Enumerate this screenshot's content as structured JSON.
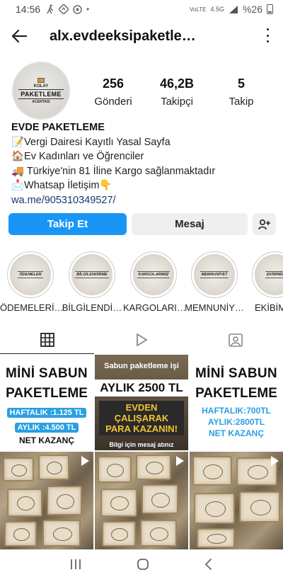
{
  "status_bar": {
    "time": "14:56",
    "network": "VoLTE",
    "signal": "4.5G",
    "battery": "%26"
  },
  "header": {
    "username": "alx.evdeeksipaketle…"
  },
  "profile": {
    "avatar": {
      "line1": "KOLAY",
      "line2": "PAKETLEME",
      "line3": "ACENTASI"
    },
    "stats": [
      {
        "value": "256",
        "label": "Gönderi"
      },
      {
        "value": "46,2B",
        "label": "Takipçi"
      },
      {
        "value": "5",
        "label": "Takip"
      }
    ],
    "name": "EVDE PAKETLEME",
    "bio": [
      "📝Vergi Dairesi Kayıtlı Yasal Sayfa",
      "🏠Ev Kadınları ve Öğrenciler",
      "🚚 Türkiye'nin 81 İline  Kargo sağlanmaktadır",
      "📩Whatsap İletişim👇"
    ],
    "link": "wa.me/905310349527/"
  },
  "actions": {
    "follow": "Takip Et",
    "message": "Mesaj"
  },
  "highlights": [
    {
      "badge": "ÖDEMELER",
      "caption": "ÖDEMELERİ…"
    },
    {
      "badge": "BİLGİLENDİRME",
      "caption": "BİLGİLENDİ…"
    },
    {
      "badge": "KARGOLARIMIZ",
      "caption": "KARGOLARI…"
    },
    {
      "badge": "MEMNUNİYET",
      "caption": "MEMNUNİY…"
    },
    {
      "badge": "EKİBİMİZ",
      "caption": "EKİBİM"
    }
  ],
  "posts": {
    "p1": {
      "l1": "MİNİ SABUN",
      "l2": "PAKETLEME",
      "l3": "HAFTALIK :1.125 TL",
      "l4": "AYLIK :4.500 TL",
      "l5": "NET KAZANÇ"
    },
    "p2": {
      "l1": "Sabun paketleme işi",
      "l2": "AYLIK 2500 TL",
      "l3": "EVDEN ÇALIŞARAK",
      "l4": "PARA KAZANIN!",
      "l5": "Bilgi için mesaj atınız"
    },
    "p3": {
      "l1": "MİNİ SABUN",
      "l2": "PAKETLEME",
      "l3": "HAFTALIK:700TL",
      "l4": "AYLIK:2800TL",
      "l5": "NET KAZANÇ"
    }
  }
}
